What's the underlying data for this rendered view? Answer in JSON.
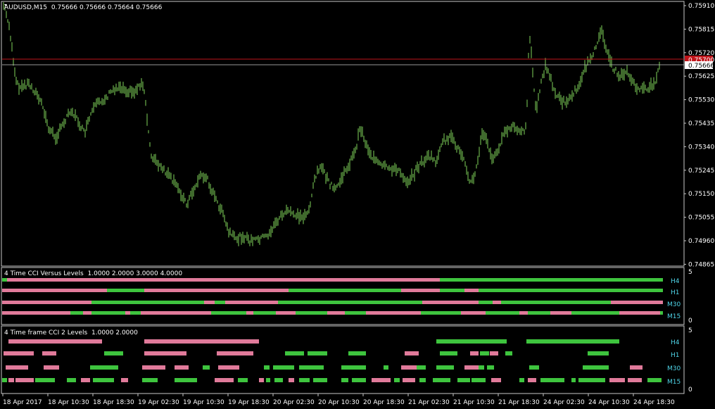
{
  "main_chart": {
    "title": "AUDUSD,M15",
    "ohlc": "0.75666 0.75666 0.75664 0.75666",
    "price_ticks": [
      "0.75910",
      "0.75815",
      "0.75720",
      "0.75625",
      "0.75530",
      "0.75435",
      "0.75340",
      "0.75245",
      "0.75150",
      "0.75055",
      "0.74960",
      "0.74865"
    ],
    "current_price": "0.75666",
    "red_line_label": "0.75700",
    "colors": {
      "bars": "#7fd35a",
      "red_line": "#c0141a",
      "grid": "#c8c8c8"
    }
  },
  "time_axis": {
    "labels": [
      "18 Apr 2017",
      "18 Apr 10:30",
      "18 Apr 18:30",
      "19 Apr 02:30",
      "19 Apr 10:30",
      "19 Apr 18:30",
      "20 Apr 02:30",
      "20 Apr 10:30",
      "20 Apr 18:30",
      "21 Apr 02:30",
      "21 Apr 10:30",
      "21 Apr 18:30",
      "24 Apr 02:30",
      "24 Apr 10:30",
      "24 Apr 18:30"
    ]
  },
  "panel1": {
    "title": "4 Time CCI Versus Levels",
    "levels": "1.0000 2.0000 3.0000 4.0000",
    "scale_top": "5",
    "scale_bottom": "0",
    "labels": [
      "H4",
      "H1",
      "M30",
      "M15"
    ]
  },
  "panel2": {
    "title": "4 Time frame CCI 2 Levels",
    "levels": "1.0000 2.0000",
    "scale_top": "5",
    "scale_bottom": "0",
    "labels": [
      "H4",
      "H1",
      "M30",
      "M15"
    ]
  },
  "colors": {
    "green": "#3ec43e",
    "pink": "#e07a9a",
    "cyan": "#4fd4e8"
  }
}
